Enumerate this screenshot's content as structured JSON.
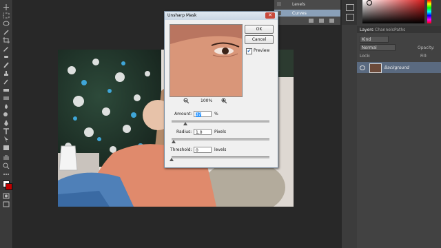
{
  "history": {
    "items": [
      {
        "label": "Levels"
      },
      {
        "label": "Curves"
      }
    ]
  },
  "layers_panel": {
    "tabs": [
      {
        "label": "Layers"
      },
      {
        "label": "Channels"
      },
      {
        "label": "Paths"
      }
    ],
    "kind_label": "Kind",
    "blend_mode": "Normal",
    "opacity_label": "Opacity:",
    "lock_label": "Lock:",
    "fill_label": "Fill:",
    "layers": [
      {
        "name": "Background"
      }
    ]
  },
  "dialog": {
    "title": "Unsharp Mask",
    "ok_label": "OK",
    "cancel_label": "Cancel",
    "preview_label": "Preview",
    "preview_checked": true,
    "zoom": "100%",
    "amount": {
      "label": "Amount:",
      "value": "37",
      "unit": "%",
      "level": 0.14
    },
    "radius": {
      "label": "Radius:",
      "value": "1,0",
      "unit": "Pixels",
      "level": 0.02
    },
    "threshold": {
      "label": "Threshold:",
      "value": "0",
      "unit": "levels",
      "level": 0.0
    }
  },
  "colors": {
    "accent_blue": "#3399ff",
    "foreground": "#ffffff",
    "background": "#c00000"
  }
}
